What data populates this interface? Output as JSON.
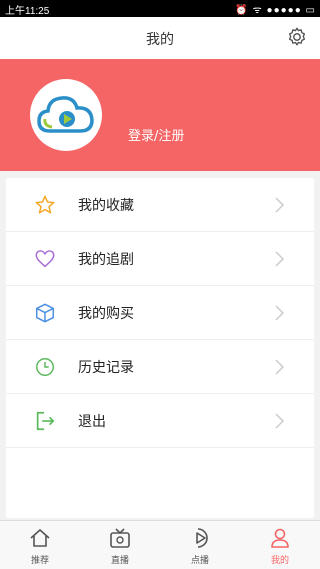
{
  "status_bar": {
    "time": "上午11:25",
    "icons_text": "⏰ ᯤ ●●●●● ▭"
  },
  "header": {
    "title": "我的"
  },
  "profile": {
    "login_label": "登录/注册"
  },
  "menu": [
    {
      "label": "我的收藏",
      "icon": "star-icon",
      "color": "#f5a623"
    },
    {
      "label": "我的追剧",
      "icon": "heart-icon",
      "color": "#a569d6"
    },
    {
      "label": "我的购买",
      "icon": "box-icon",
      "color": "#4a90e2"
    },
    {
      "label": "历史记录",
      "icon": "clock-icon",
      "color": "#5cb85c"
    },
    {
      "label": "退出",
      "icon": "exit-icon",
      "color": "#5cb85c"
    }
  ],
  "tabs": [
    {
      "label": "推荐",
      "icon": "home-icon"
    },
    {
      "label": "直播",
      "icon": "tv-icon"
    },
    {
      "label": "点播",
      "icon": "play-icon"
    },
    {
      "label": "我的",
      "icon": "user-icon",
      "active": true
    }
  ],
  "colors": {
    "accent": "#f56566"
  }
}
